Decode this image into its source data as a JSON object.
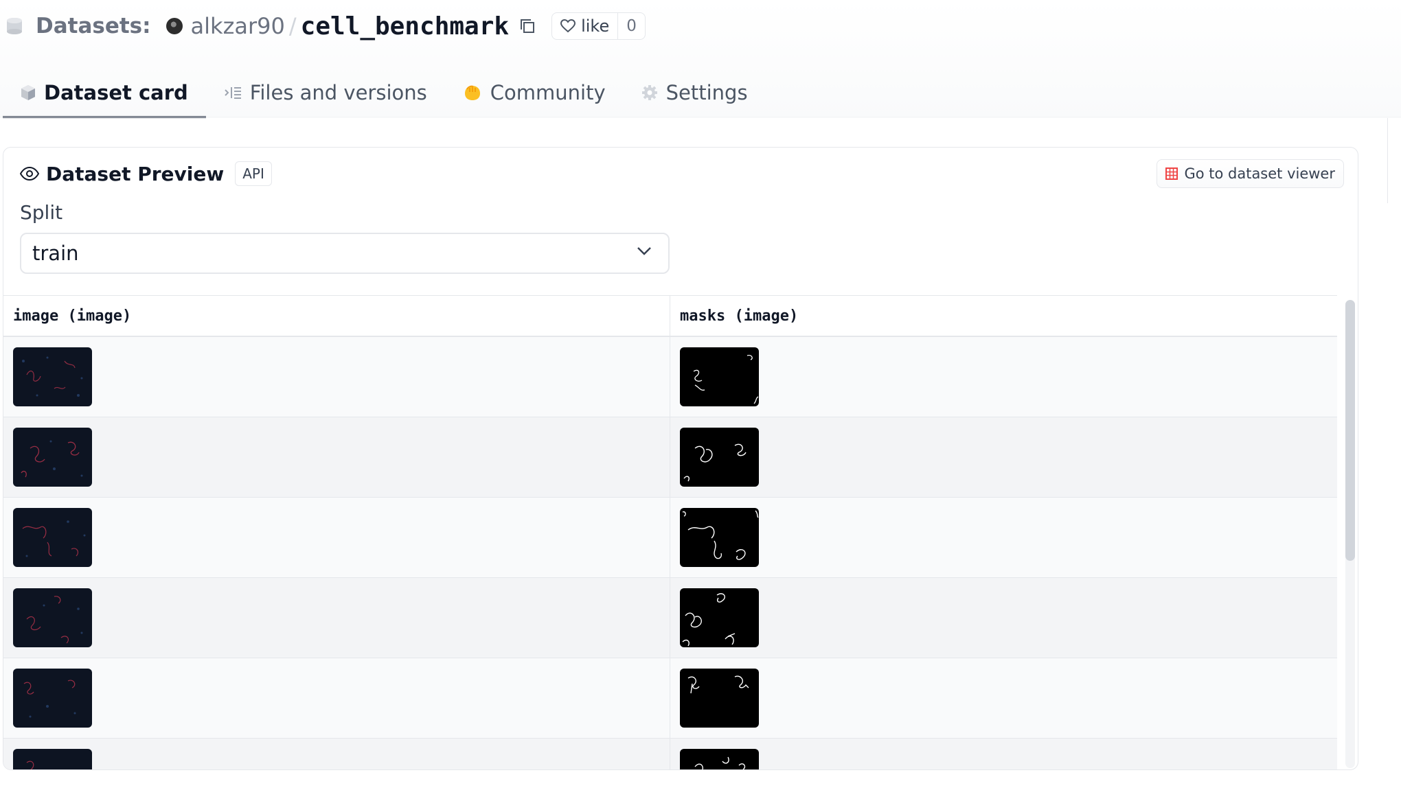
{
  "header": {
    "section_label": "Datasets:",
    "owner": "alkzar90",
    "separator": "/",
    "repo_name": "cell_benchmark",
    "like_label": "like",
    "like_count": "0",
    "icons": [
      "database-icon",
      "avatar",
      "copy-icon",
      "heart-icon"
    ]
  },
  "tabs": [
    {
      "label": "Dataset card",
      "icon": "cube-icon",
      "active": true
    },
    {
      "label": "Files and versions",
      "icon": "files-icon",
      "active": false
    },
    {
      "label": "Community",
      "icon": "community-icon",
      "active": false
    },
    {
      "label": "Settings",
      "icon": "gear-icon",
      "active": false
    }
  ],
  "preview": {
    "title": "Dataset Preview",
    "api_badge": "API",
    "viewer_button": "Go to dataset viewer",
    "split_label": "Split",
    "split_value": "train",
    "columns": [
      "image (image)",
      "masks (image)"
    ],
    "row_count_visible": 6
  },
  "colors": {
    "accent_red": "#ef4444",
    "community_yellow": "#fbbf24",
    "border": "#e5e7eb",
    "image_bg": "#0d1422",
    "mask_bg": "#000000"
  }
}
